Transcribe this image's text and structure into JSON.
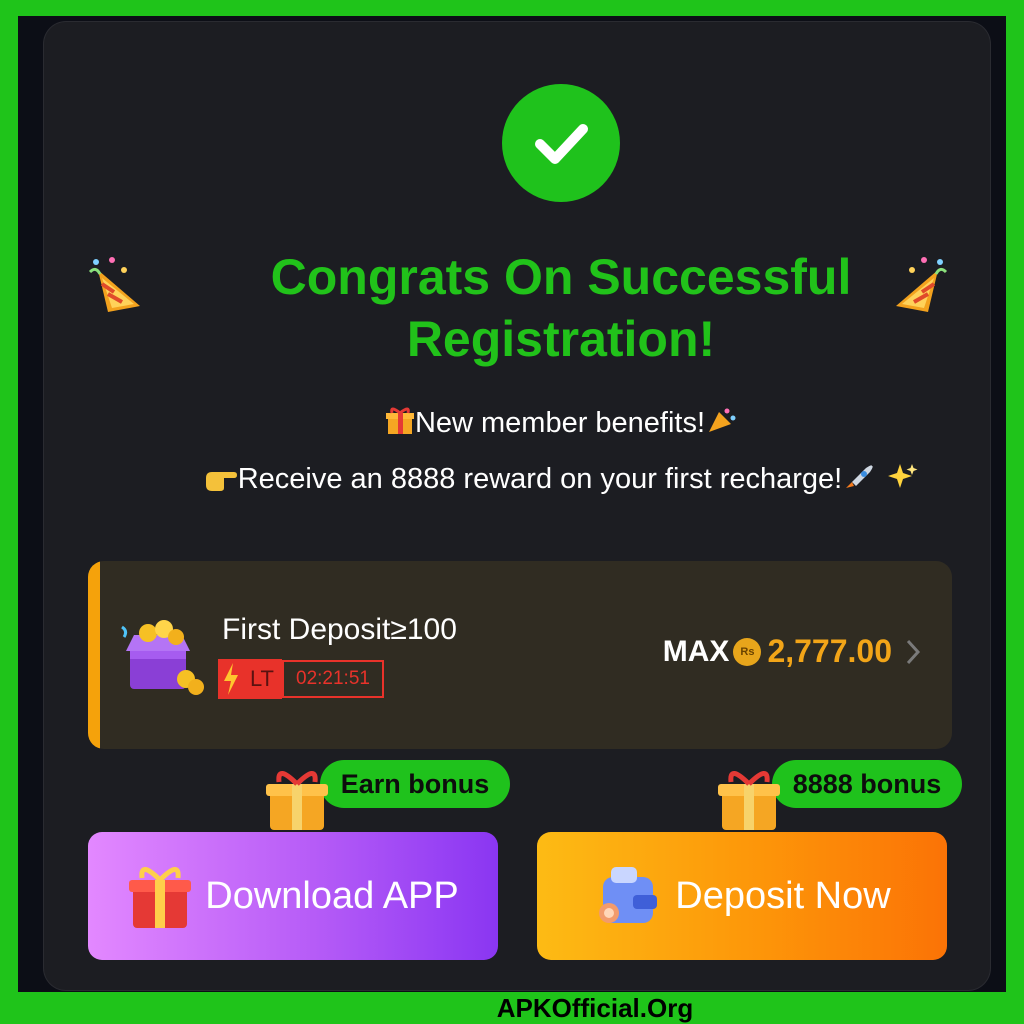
{
  "modal": {
    "title_line1": "Congrats On Successful",
    "title_line2": "Registration!",
    "benefits_text": "New member benefits!",
    "reward_text": "Receive an 8888 reward on your first recharge!"
  },
  "deposit_offer": {
    "title": "First Deposit≥100",
    "timer_label": "LT",
    "timer_value": "02:21:51",
    "max_label": "MAX",
    "currency_symbol": "Rs",
    "max_amount": "2,777.00"
  },
  "actions": {
    "download": {
      "tag": "Earn bonus",
      "label": "Download APP"
    },
    "deposit": {
      "tag": "8888 bonus",
      "label": "Deposit Now"
    }
  },
  "icons": [
    "check-icon",
    "party-popper-icon",
    "gift-icon",
    "pointing-hand-icon",
    "rocket-icon",
    "sparkles-icon",
    "treasure-chest-icon",
    "lightning-icon",
    "rupee-coin-icon",
    "chevron-right-icon",
    "wallet-icon"
  ],
  "colors": {
    "accent_green": "#21c21a",
    "accent_orange": "#f5a20b",
    "timer_red": "#e8322a"
  },
  "watermark": "APKOfficial.Org"
}
